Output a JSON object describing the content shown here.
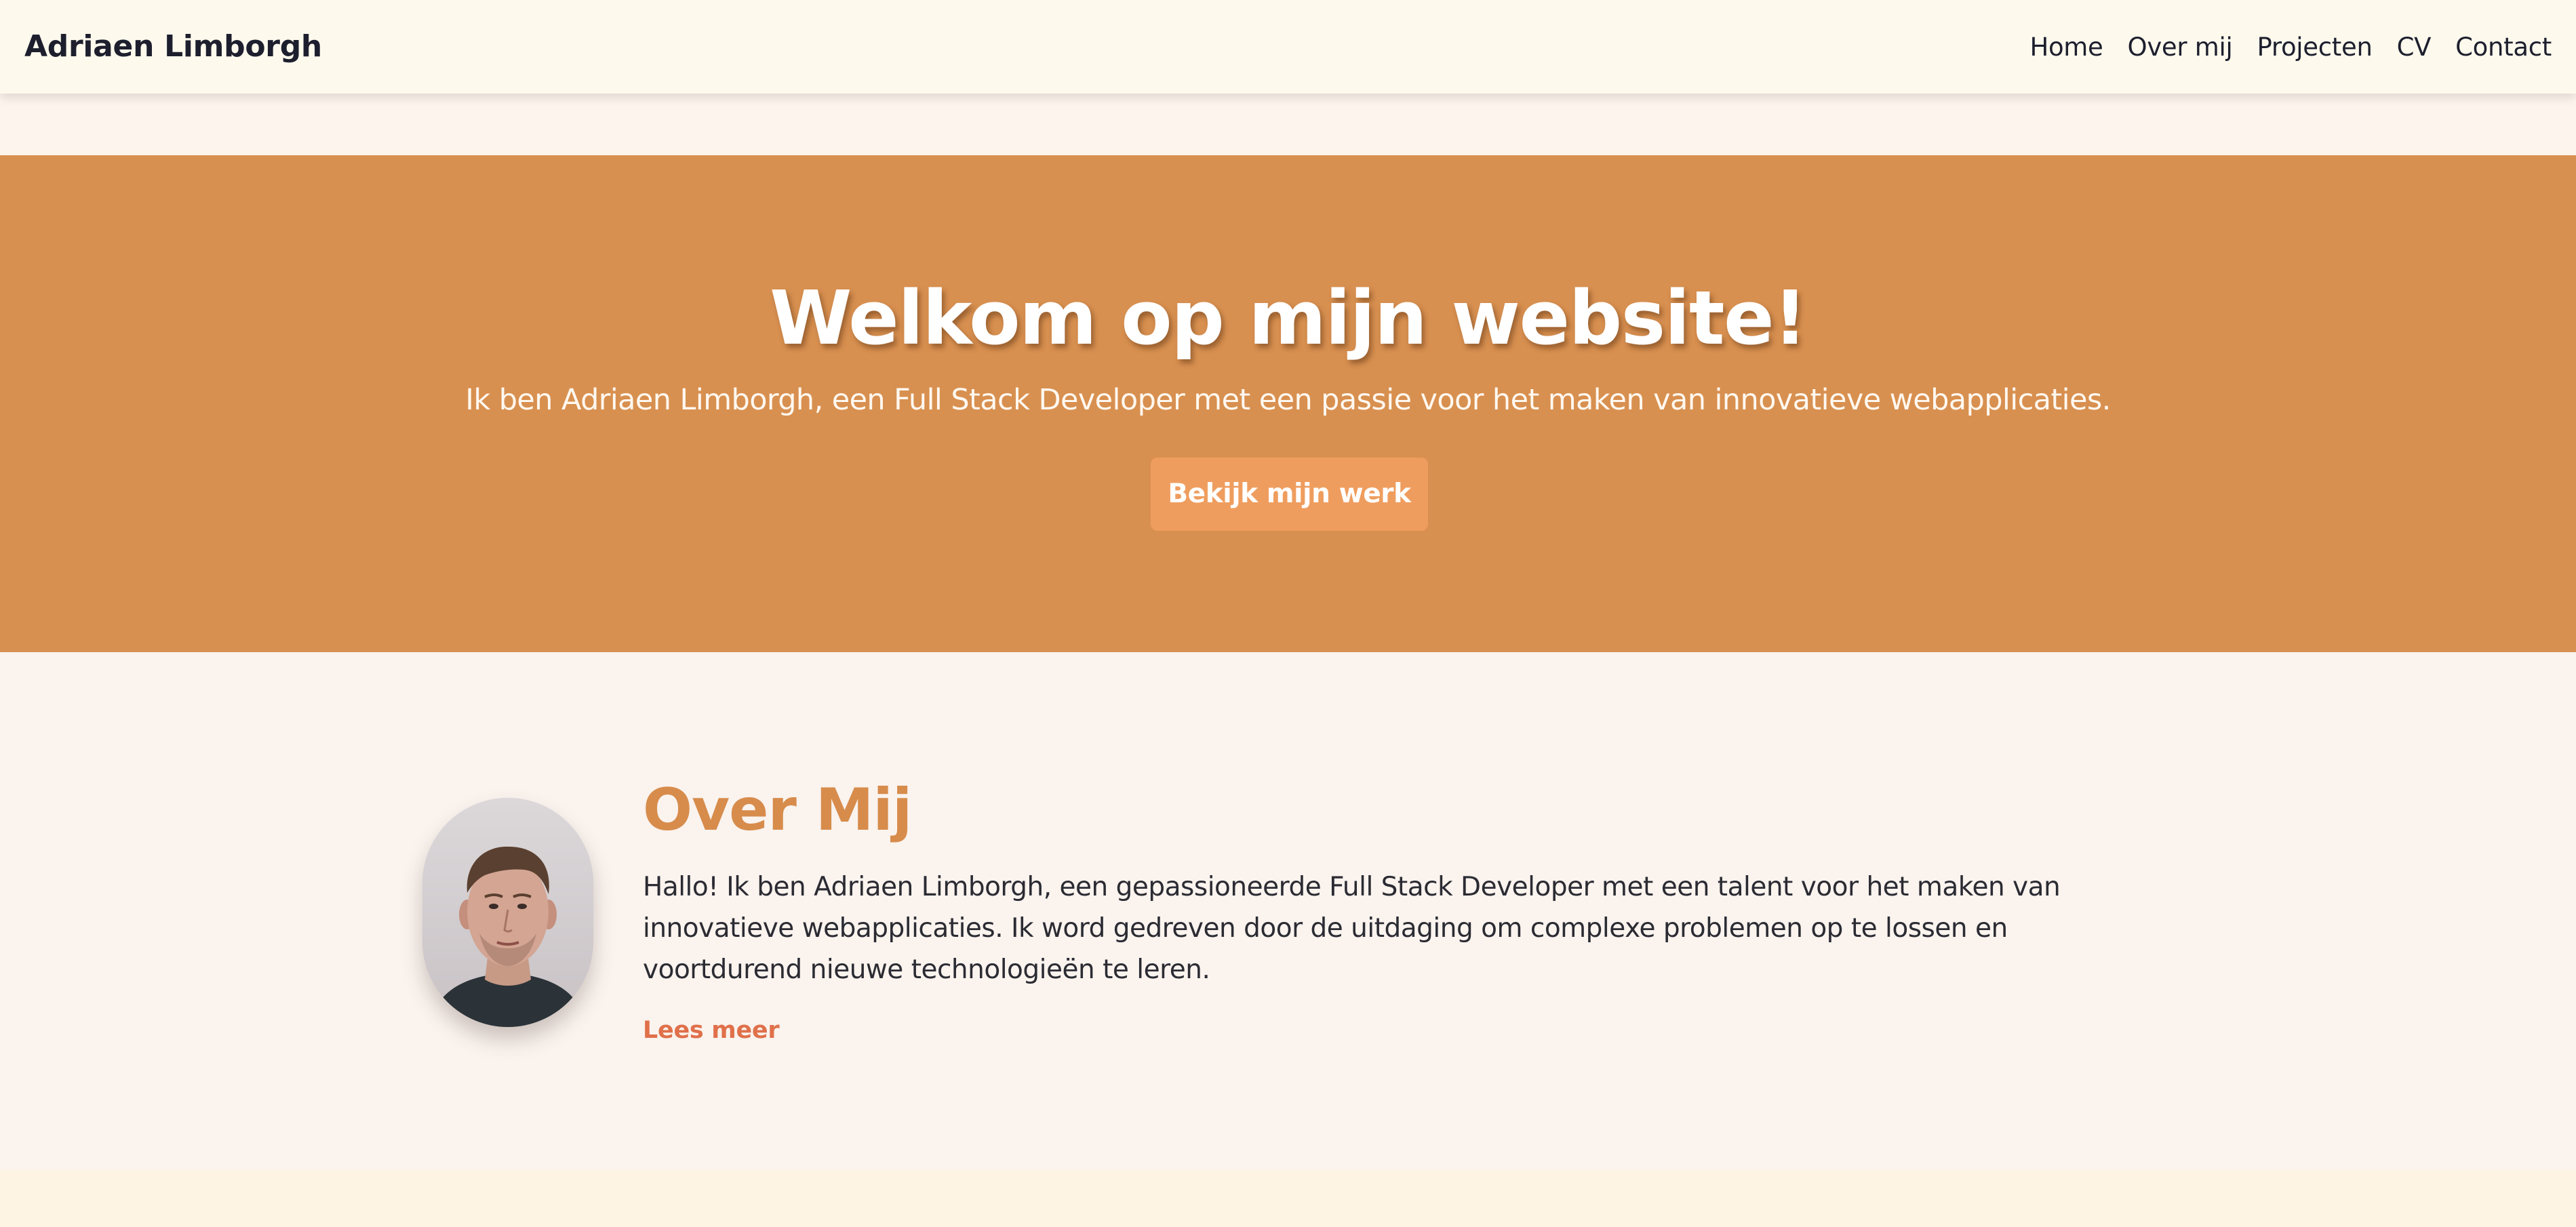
{
  "header": {
    "brand": "Adriaen Limborgh",
    "nav": [
      "Home",
      "Over mij",
      "Projecten",
      "CV",
      "Contact"
    ]
  },
  "hero": {
    "title": "Welkom op mijn website!",
    "subtitle": "Ik ben Adriaen Limborgh, een Full Stack Developer met een passie voor het maken van innovatieve webapplicaties.",
    "cta_label": "Bekijk mijn werk"
  },
  "about": {
    "title": "Over Mij",
    "text": "Hallo! Ik ben Adriaen Limborgh, een gepassioneerde Full Stack Developer met een talent voor het maken van innovatieve webapplicaties. Ik word gedreven door de uitdaging om complexe problemen op te lossen en voortdurend nieuwe technologieën te leren.",
    "read_more": "Lees meer"
  },
  "colors": {
    "navbar_bg": "#fdf9ed",
    "hero_bg": "#d89050",
    "cta_bg": "#ef9d5e",
    "accent_heading": "#d78c4c",
    "link": "#e0704a",
    "page_bg": "#faf3ee"
  }
}
